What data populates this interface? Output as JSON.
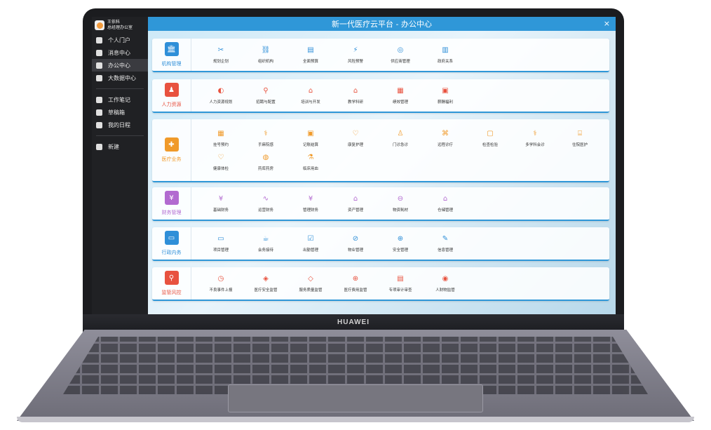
{
  "device": {
    "brand": "HUAWEI"
  },
  "sidebar": {
    "user": {
      "name": "王依科",
      "dept": "总经理办公室"
    },
    "items": [
      {
        "label": "个人门户",
        "icon": "home-icon"
      },
      {
        "label": "消息中心",
        "icon": "message-icon"
      },
      {
        "label": "办公中心",
        "icon": "briefcase-icon",
        "active": true
      },
      {
        "label": "大数据中心",
        "icon": "data-icon"
      },
      {
        "label": "工作笔记",
        "icon": "notebook-icon"
      },
      {
        "label": "草稿箱",
        "icon": "drafts-icon"
      },
      {
        "label": "我的日程",
        "icon": "calendar-icon"
      },
      {
        "label": "新建",
        "icon": "new-icon"
      }
    ]
  },
  "header": {
    "title": "新一代医疗云平台 - 办公中心",
    "close": "×"
  },
  "categories": [
    {
      "label": "机构管理",
      "color": "#2f8fd8",
      "icon": "institution-icon",
      "glyph": "🏛",
      "items": [
        {
          "label": "规划企划",
          "glyph": "✂"
        },
        {
          "label": "组织机构",
          "glyph": "⛓"
        },
        {
          "label": "全面预算",
          "glyph": "▤"
        },
        {
          "label": "风险预警",
          "glyph": "⚡"
        },
        {
          "label": "供应商管理",
          "glyph": "◎"
        },
        {
          "label": "政府关系",
          "glyph": "▥"
        }
      ]
    },
    {
      "label": "人力资源",
      "color": "#e8523f",
      "icon": "hr-icon",
      "glyph": "♟",
      "items": [
        {
          "label": "人力资源规划",
          "glyph": "◐"
        },
        {
          "label": "招聘与配置",
          "glyph": "⚲"
        },
        {
          "label": "培训与开发",
          "glyph": "⌂"
        },
        {
          "label": "教学科研",
          "glyph": "⌂"
        },
        {
          "label": "绩效管理",
          "glyph": "▦"
        },
        {
          "label": "薪酬福利",
          "glyph": "▣"
        }
      ]
    },
    {
      "label": "医疗业务",
      "color": "#f09a2a",
      "icon": "medical-icon",
      "glyph": "✚",
      "items": [
        {
          "label": "挂号预约",
          "glyph": "▦"
        },
        {
          "label": "手麻院感",
          "glyph": "⚕"
        },
        {
          "label": "记账结算",
          "glyph": "▣"
        },
        {
          "label": "康复护理",
          "glyph": "♡"
        },
        {
          "label": "门诊急诊",
          "glyph": "♙"
        },
        {
          "label": "远程诊疗",
          "glyph": "⌘"
        },
        {
          "label": "检查检验",
          "glyph": "▢"
        },
        {
          "label": "多学科会诊",
          "glyph": "⚕"
        },
        {
          "label": "住院医护",
          "glyph": "⌸"
        },
        {
          "label": "健康体检",
          "glyph": "♡"
        },
        {
          "label": "药库药房",
          "glyph": "◍"
        },
        {
          "label": "临床用血",
          "glyph": "⚗"
        }
      ]
    },
    {
      "label": "财务管理",
      "color": "#b26ad0",
      "icon": "finance-icon",
      "glyph": "¥",
      "items": [
        {
          "label": "基础财务",
          "glyph": "¥"
        },
        {
          "label": "运营财务",
          "glyph": "∿"
        },
        {
          "label": "管理财务",
          "glyph": "¥"
        },
        {
          "label": "资产管理",
          "glyph": "⌂"
        },
        {
          "label": "物资耗材",
          "glyph": "⊖"
        },
        {
          "label": "仓储管理",
          "glyph": "⌂"
        }
      ]
    },
    {
      "label": "行政内务",
      "color": "#2f8fd8",
      "icon": "admin-icon",
      "glyph": "▭",
      "items": [
        {
          "label": "项目管理",
          "glyph": "▭"
        },
        {
          "label": "会务接待",
          "glyph": "☕"
        },
        {
          "label": "出勤管理",
          "glyph": "☑"
        },
        {
          "label": "物业管理",
          "glyph": "⊘"
        },
        {
          "label": "安全管理",
          "glyph": "⊕"
        },
        {
          "label": "信息管理",
          "glyph": "✎"
        }
      ]
    },
    {
      "label": "监管风控",
      "color": "#e8523f",
      "icon": "risk-icon",
      "glyph": "⚲",
      "items": [
        {
          "label": "不良事件上报",
          "glyph": "◷"
        },
        {
          "label": "医疗安全监管",
          "glyph": "◈"
        },
        {
          "label": "服务质量监管",
          "glyph": "◇"
        },
        {
          "label": "医疗费用监管",
          "glyph": "⊕"
        },
        {
          "label": "专项审计审查",
          "glyph": "▤"
        },
        {
          "label": "人财物监管",
          "glyph": "◉"
        }
      ]
    }
  ]
}
